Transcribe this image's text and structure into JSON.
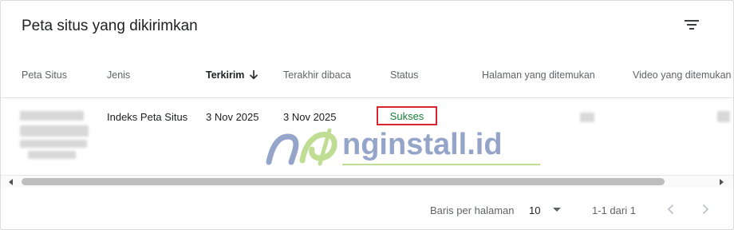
{
  "card": {
    "title": "Peta situs yang dikirimkan",
    "filter_icon": "filter-list-icon"
  },
  "table": {
    "columns": [
      {
        "label": "Peta Situs"
      },
      {
        "label": "Jenis"
      },
      {
        "label": "Terkirim",
        "sorted": "descending"
      },
      {
        "label": "Terakhir dibaca"
      },
      {
        "label": "Status"
      },
      {
        "label": "Halaman yang ditemukan"
      },
      {
        "label": "Video yang ditemukan"
      }
    ],
    "rows": [
      {
        "jenis": "Indeks Peta Situs",
        "terkirim": "3 Nov 2025",
        "terakhir_dibaca": "3 Nov 2025",
        "status": "Sukses"
      }
    ]
  },
  "watermark": {
    "logo_text": "nginstall.id"
  },
  "pagination": {
    "rows_label": "Baris per halaman",
    "rows_value": "10",
    "range": "1-1 dari 1",
    "prev_icon": "chevron-left-icon",
    "next_icon": "chevron-right-icon"
  },
  "colors": {
    "status_success": "#188038",
    "highlight_box": "#d9232e",
    "watermark_blue": "#3f5a9e",
    "watermark_green": "#8cc43d"
  }
}
